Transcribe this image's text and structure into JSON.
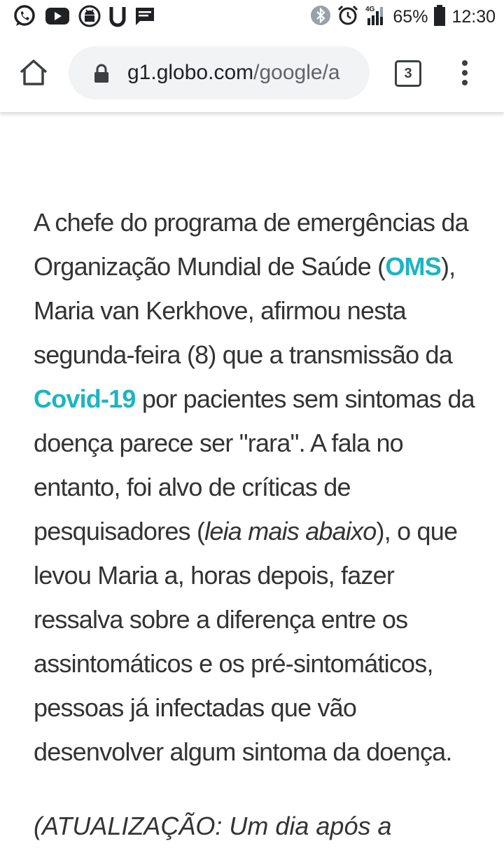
{
  "status_bar": {
    "battery": "65%",
    "time": "12:30",
    "network": "4G",
    "icons": [
      "whatsapp-icon",
      "youtube-icon",
      "android-icon",
      "u-app-icon",
      "message-icon",
      "bluetooth-icon",
      "alarm-icon",
      "signal-icon",
      "battery-icon"
    ]
  },
  "toolbar": {
    "url_domain": "g1.globo.com",
    "url_path": "/google/a",
    "tab_count": "3"
  },
  "article": {
    "p1_a": "A chefe do programa de emergências da Organização Mundial de Saúde (",
    "link_oms": "OMS",
    "p1_b": "), Maria van Kerkhove, afirmou nesta segunda-feira (8) que a transmissão da ",
    "link_covid": "Covid-19",
    "p1_c": " por pacientes sem sintomas da doença parece ser \"rara\". A fala no entanto, foi alvo de críticas de pesquisadores (",
    "italic_read_more": "leia mais abaixo",
    "p1_d": "), o que levou Maria a, horas depois, fazer ressalva sobre a diferença entre os assintomáticos e os pré-sintomáticos, pessoas já infectadas que vão desenvolver algum sintoma da doença.",
    "update_start": "(ATUALIZAÇÃO: Um dia após a"
  },
  "colors": {
    "link": "#1bb5c2",
    "text": "#333333",
    "url_bar_bg": "#f1f3f4"
  }
}
